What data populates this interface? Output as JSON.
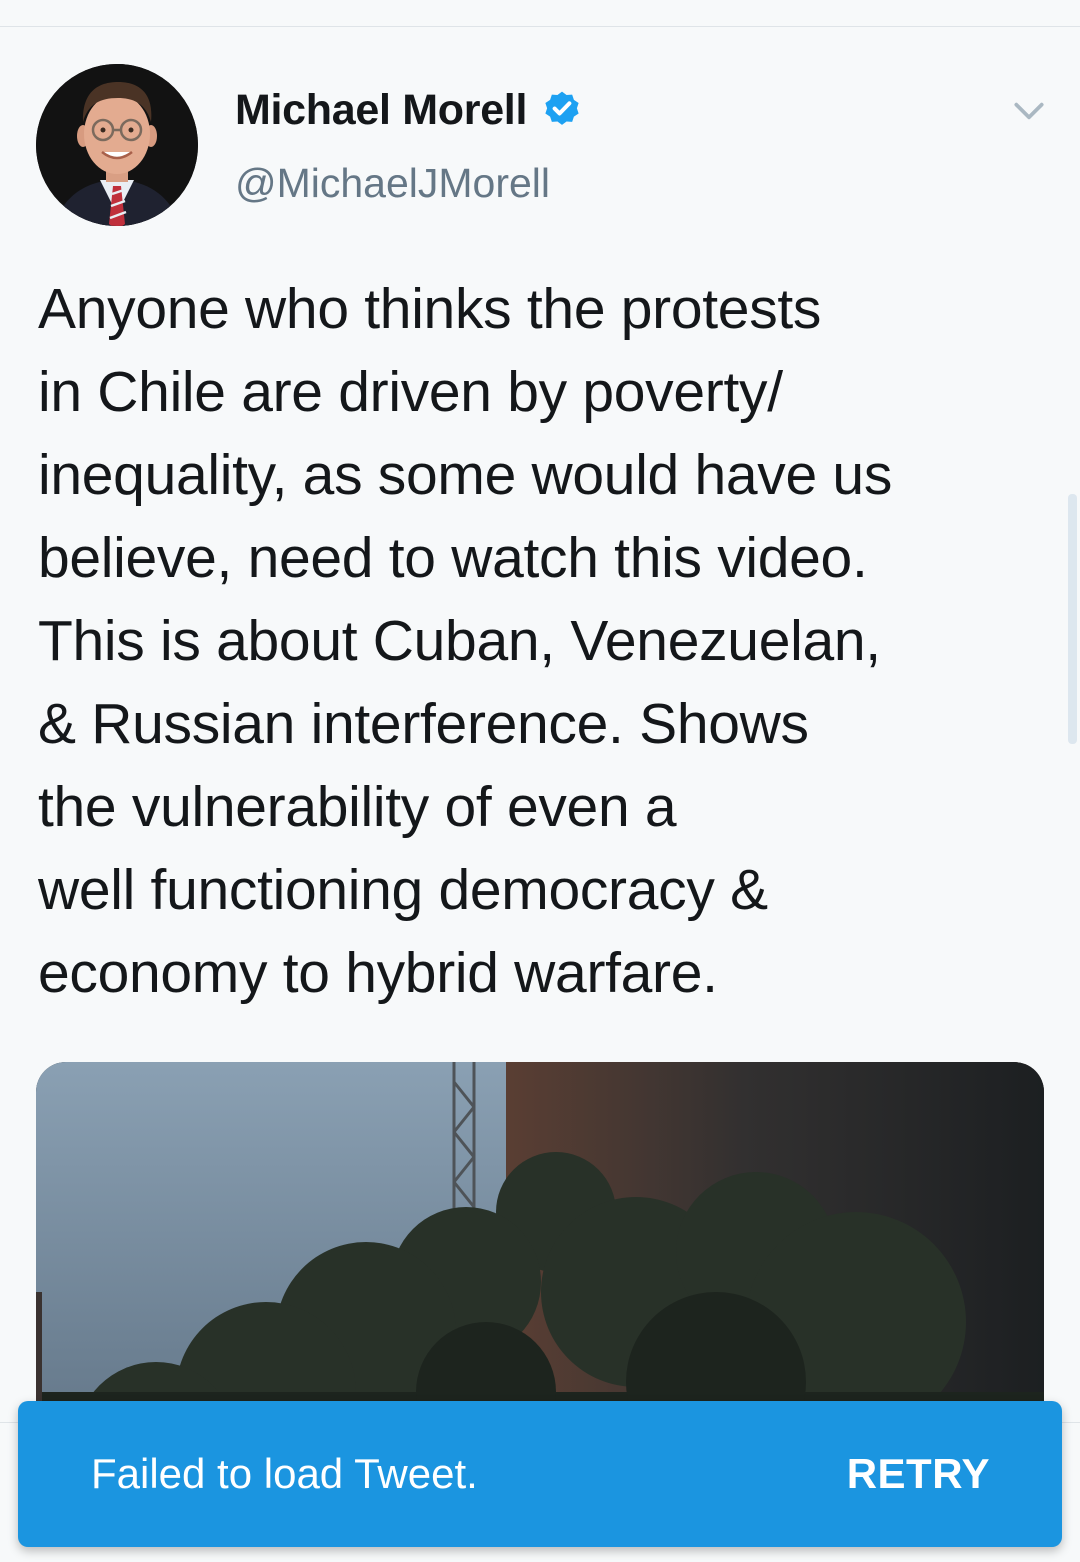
{
  "tweet": {
    "display_name": "Michael Morell",
    "handle": "@MichaelJMorell",
    "verified": true,
    "lines": [
      "Anyone who thinks the protests",
      "in Chile are driven by poverty/",
      "inequality, as some would have us",
      "believe, need to watch this video.",
      "This is about Cuban, Venezuelan,",
      "& Russian interference. Shows",
      "the vulnerability of even a",
      "well functioning democracy &",
      "economy to hybrid warfare."
    ]
  },
  "snackbar": {
    "message": "Failed to load Tweet.",
    "action_label": "RETRY"
  },
  "icons": {
    "verified": "verified-badge-icon",
    "menu": "chevron-down-icon"
  },
  "colors": {
    "background": "#f7f9fa",
    "text_primary": "#14171a",
    "text_secondary": "#657786",
    "accent_blue": "#1b95e0",
    "verified_blue": "#1da1f2",
    "chevron": "#aab8c2"
  }
}
